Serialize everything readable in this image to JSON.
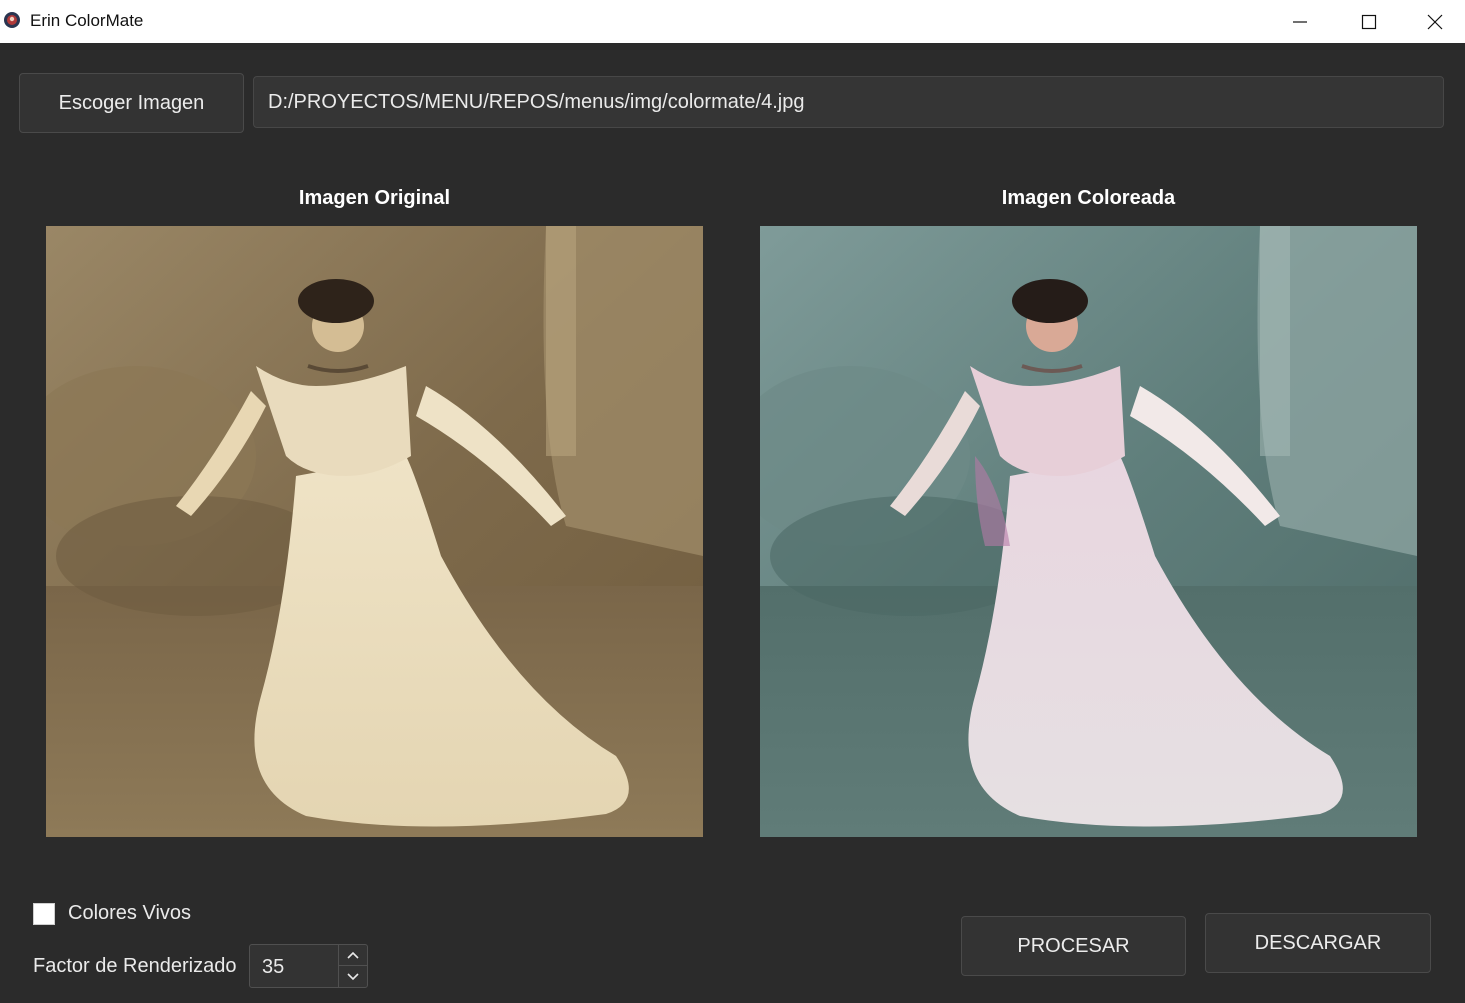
{
  "window": {
    "title": "Erin ColorMate",
    "icon": "app-icon",
    "controls": [
      "minimize-icon",
      "maximize-icon",
      "close-icon"
    ]
  },
  "toolbar": {
    "choose_label": "Escoger Imagen",
    "path_value": "D:/PROYECTOS/MENU/REPOS/menus/img/colormate/4.jpg"
  },
  "panels": {
    "original_title": "Imagen Original",
    "colored_title": "Imagen Coloreada"
  },
  "options": {
    "vivid_label": "Colores Vivos",
    "vivid_checked": false,
    "factor_label": "Factor de Renderizado",
    "factor_value": "35"
  },
  "actions": {
    "process_label": "PROCESAR",
    "download_label": "DESCARGAR"
  },
  "colors": {
    "background": "#2b2b2b",
    "button": "#333333",
    "sepia": "#8a7452",
    "teal": "#55706c"
  }
}
